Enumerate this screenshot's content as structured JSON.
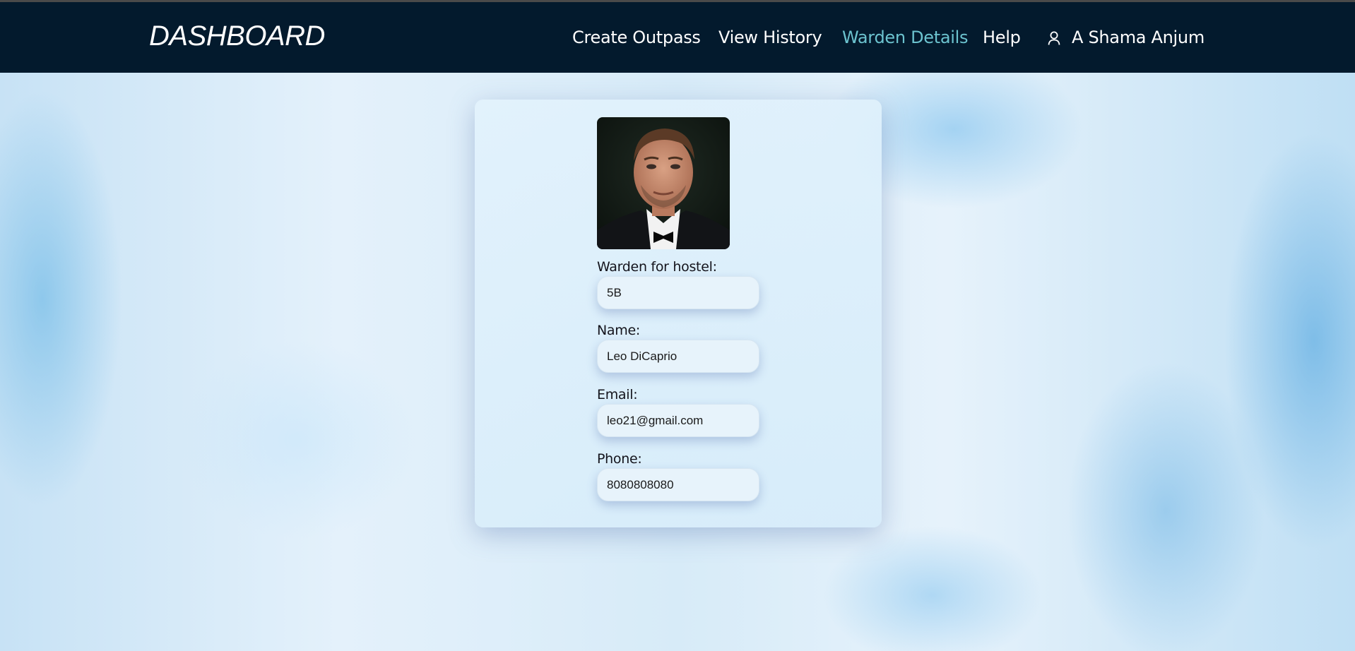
{
  "navbar": {
    "brand": "DASHBOARD",
    "items": [
      {
        "label": "Create Outpass"
      },
      {
        "label": "View History"
      },
      {
        "label": "Warden Details"
      },
      {
        "label": "Help"
      }
    ],
    "user_name": "A Shama Anjum",
    "active_color": "#6cc3cf",
    "background": "#031a2d"
  },
  "warden": {
    "hostel_label": "Warden for hostel:",
    "hostel_value": "5B",
    "name_label": "Name:",
    "name_value": "Leo DiCaprio",
    "email_label": "Email:",
    "email_value": "leo21@gmail.com",
    "phone_label": "Phone:",
    "phone_value": "8080808080"
  }
}
